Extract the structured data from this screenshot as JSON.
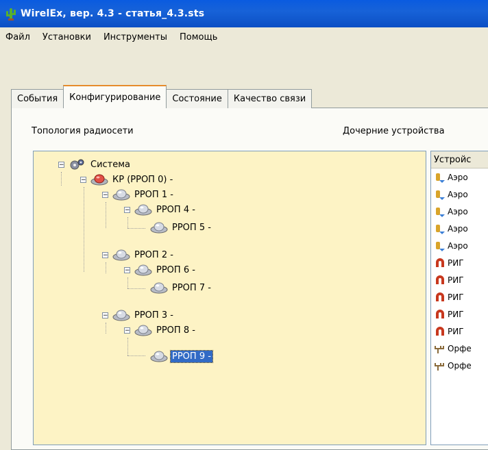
{
  "window": {
    "title": "WirelEx, вер. 4.3 - статья_4.3.sts",
    "icon": "cactus-app-icon"
  },
  "menu": [
    {
      "label": "Файл"
    },
    {
      "label": "Установки"
    },
    {
      "label": "Инструменты"
    },
    {
      "label": "Помощь"
    }
  ],
  "tabs": [
    {
      "label": "События",
      "active": false
    },
    {
      "label": "Конфигурирование",
      "active": true
    },
    {
      "label": "Состояние",
      "active": false
    },
    {
      "label": "Качество связи",
      "active": false
    }
  ],
  "panel": {
    "topology_label": "Топология радиосети",
    "children_label": "Дочерние устройства"
  },
  "tree": [
    {
      "label": "Система",
      "icon": "system-icon",
      "expanded": true,
      "selected": false
    },
    {
      "label": "КР (РРОП 0) -",
      "icon": "coordinator-icon",
      "expanded": true,
      "selected": false
    },
    {
      "label": "РРОП 1 -",
      "icon": "router-icon",
      "expanded": true,
      "selected": false
    },
    {
      "label": "РРОП 4 -",
      "icon": "router-icon",
      "expanded": true,
      "selected": false
    },
    {
      "label": "РРОП 5 -",
      "icon": "router-icon",
      "expanded": false,
      "selected": false
    },
    {
      "label": "РРОП 2 -",
      "icon": "router-icon",
      "expanded": true,
      "selected": false
    },
    {
      "label": "РРОП 6 -",
      "icon": "router-icon",
      "expanded": true,
      "selected": false
    },
    {
      "label": "РРОП 7 -",
      "icon": "router-icon",
      "expanded": false,
      "selected": false
    },
    {
      "label": "РРОП 3 -",
      "icon": "router-icon",
      "expanded": true,
      "selected": false
    },
    {
      "label": "РРОП 8 -",
      "icon": "router-icon",
      "expanded": true,
      "selected": false
    },
    {
      "label": "РРОП 9 -",
      "icon": "router-icon",
      "expanded": false,
      "selected": true
    }
  ],
  "devices": {
    "header": "Устройс",
    "rows": [
      {
        "label": "Аэро",
        "icon": "aero-sensor-icon"
      },
      {
        "label": "Аэро",
        "icon": "aero-sensor-icon"
      },
      {
        "label": "Аэро",
        "icon": "aero-sensor-icon"
      },
      {
        "label": "Аэро",
        "icon": "aero-sensor-icon"
      },
      {
        "label": "Аэро",
        "icon": "aero-sensor-icon"
      },
      {
        "label": "РИГ",
        "icon": "horseshoe-magnet-icon"
      },
      {
        "label": "РИГ",
        "icon": "horseshoe-magnet-icon"
      },
      {
        "label": "РИГ",
        "icon": "horseshoe-magnet-icon"
      },
      {
        "label": "РИГ",
        "icon": "horseshoe-magnet-icon"
      },
      {
        "label": "РИГ",
        "icon": "horseshoe-magnet-icon"
      },
      {
        "label": "Орфе",
        "icon": "antenna-icon"
      },
      {
        "label": "Орфе",
        "icon": "antenna-icon"
      }
    ]
  },
  "colors": {
    "titlebar": "#0a5be0",
    "tree_background": "#fdf3c5",
    "selection": "#316ac5",
    "active_tab_accent": "#e68b2c"
  }
}
